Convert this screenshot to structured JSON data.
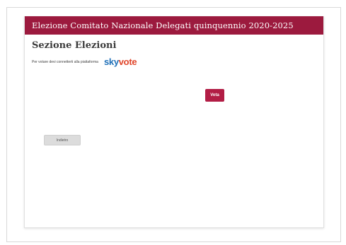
{
  "header": {
    "title": "Elezione Comitato Nazionale Delegati quinquennio 2020-2025"
  },
  "section": {
    "title": "Sezione Elezioni",
    "instruction": "Per votare devi connetterti alla piattaforma"
  },
  "logo": {
    "part1": "sky",
    "part2": "vote",
    "icon": "skyvote-logo"
  },
  "actions": {
    "vote_label": "Vota",
    "back_label": "Indietro"
  },
  "colors": {
    "header_bg": "#9c1a3e",
    "vote_button": "#b21d45",
    "logo_blue": "#1d6fb8",
    "logo_red": "#e0452a"
  }
}
